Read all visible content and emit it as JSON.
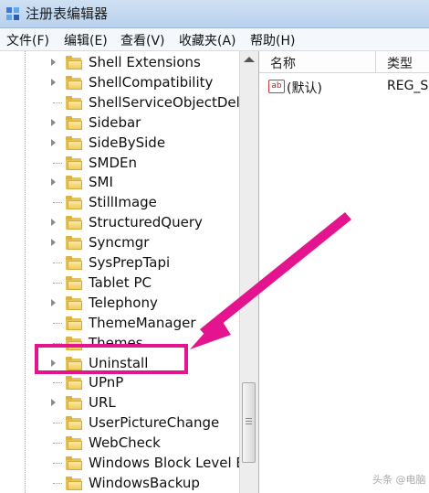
{
  "window": {
    "title": "注册表编辑器"
  },
  "menu": [
    {
      "label": "文件(F)"
    },
    {
      "label": "编辑(E)"
    },
    {
      "label": "查看(V)"
    },
    {
      "label": "收藏夹(A)"
    },
    {
      "label": "帮助(H)"
    }
  ],
  "tree": {
    "items": [
      {
        "label": "Shell Extensions",
        "expandable": true
      },
      {
        "label": "ShellCompatibility",
        "expandable": true
      },
      {
        "label": "ShellServiceObjectDela",
        "expandable": false
      },
      {
        "label": "Sidebar",
        "expandable": true
      },
      {
        "label": "SideBySide",
        "expandable": true
      },
      {
        "label": "SMDEn",
        "expandable": false
      },
      {
        "label": "SMI",
        "expandable": true
      },
      {
        "label": "StillImage",
        "expandable": false
      },
      {
        "label": "StructuredQuery",
        "expandable": true
      },
      {
        "label": "Syncmgr",
        "expandable": true
      },
      {
        "label": "SysPrepTapi",
        "expandable": false
      },
      {
        "label": "Tablet PC",
        "expandable": false
      },
      {
        "label": "Telephony",
        "expandable": true
      },
      {
        "label": "ThemeManager",
        "expandable": false
      },
      {
        "label": "Themes",
        "expandable": false
      },
      {
        "label": "Uninstall",
        "expandable": true,
        "highlighted": true
      },
      {
        "label": "UPnP",
        "expandable": false
      },
      {
        "label": "URL",
        "expandable": true
      },
      {
        "label": "UserPictureChange",
        "expandable": false
      },
      {
        "label": "WebCheck",
        "expandable": false
      },
      {
        "label": "Windows Block Level Ba",
        "expandable": false
      },
      {
        "label": "WindowsBackup",
        "expandable": false
      }
    ]
  },
  "values_pane": {
    "columns": {
      "name": "名称",
      "type": "类型"
    },
    "rows": [
      {
        "icon": "string-value-icon",
        "icon_text": "ab",
        "name": "(默认)",
        "type": "REG_S"
      }
    ]
  },
  "annotation": {
    "color": "#e4148f"
  },
  "watermark": {
    "text": "头条 @电脑"
  }
}
